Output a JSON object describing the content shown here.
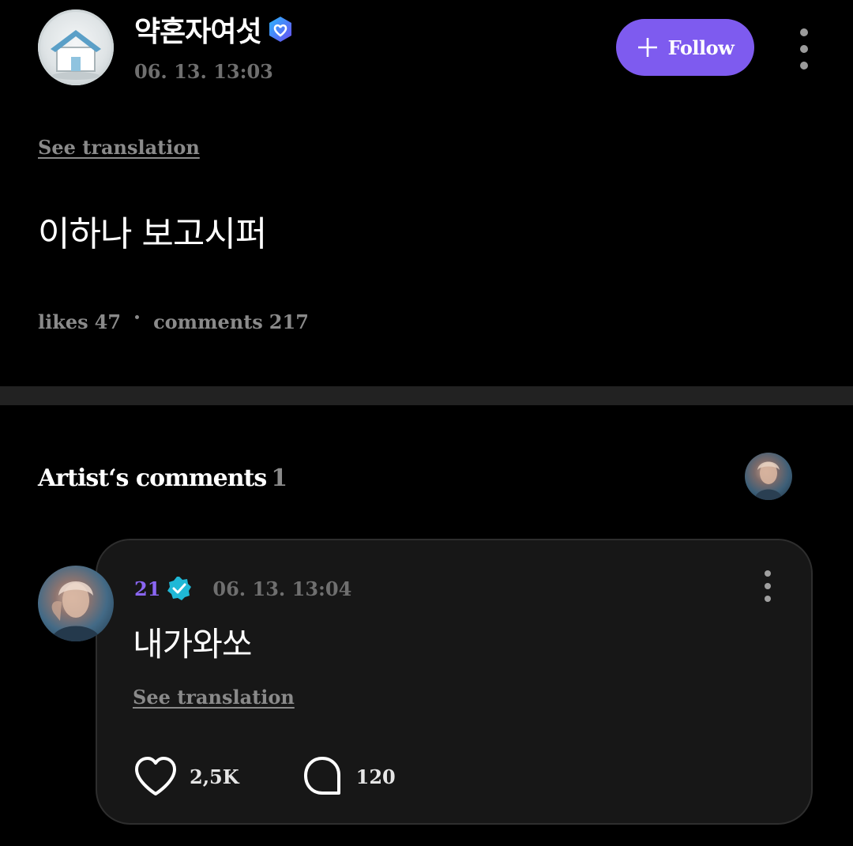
{
  "post": {
    "author_name": "약혼자여섯",
    "timestamp": "06. 13. 13:03",
    "follow_label": "Follow",
    "see_translation": "See translation",
    "body": "이하나 보고시퍼",
    "likes_label": "likes",
    "likes_count": "47",
    "comments_label": "comments",
    "comments_count": "217",
    "avatar_icon": "house-icon"
  },
  "artist_comments": {
    "heading": "Artist‘s comments",
    "count": "1",
    "comment": {
      "author_name": "21",
      "timestamp": "06. 13. 13:04",
      "body": "내가와쏘",
      "see_translation": "See translation",
      "like_count": "2,5K",
      "reply_count": "120"
    }
  },
  "colors": {
    "background": "#000000",
    "accent": "#7e5bef",
    "card": "#171717",
    "artist_name": "#8a66f2",
    "artist_badge": "#1fb8d6",
    "muted_text": "#8a8a8a"
  }
}
